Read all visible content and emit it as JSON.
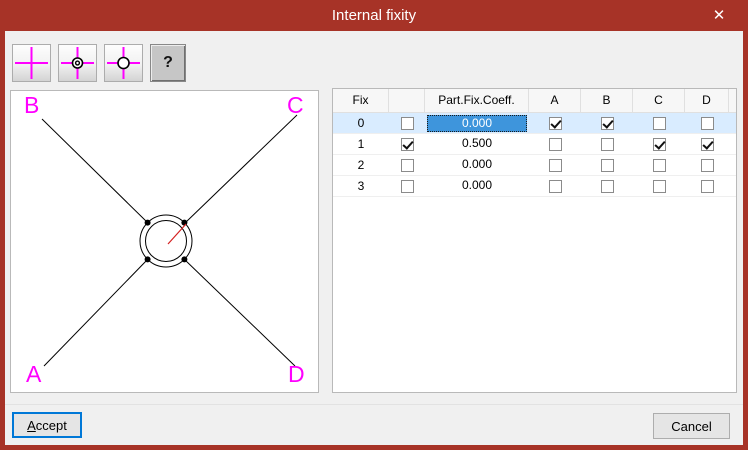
{
  "window": {
    "title": "Internal fixity",
    "close_icon": "✕"
  },
  "toolbar": {
    "buttons": [
      {
        "name": "fixity-rigid",
        "icon": "crosshair-icon"
      },
      {
        "name": "fixity-hinge-target",
        "icon": "crosshair-target-icon"
      },
      {
        "name": "fixity-hinge-circle",
        "icon": "crosshair-circle-icon"
      },
      {
        "name": "help",
        "label": "?"
      }
    ]
  },
  "diagram": {
    "labels": [
      "B",
      "C",
      "A",
      "D"
    ],
    "label_color": "#FF00FF",
    "line_color": "#000000",
    "pointer_color": "#D42020"
  },
  "table": {
    "headers": [
      "Fix",
      "",
      "Part.Fix.Coeff.",
      "A",
      "B",
      "C",
      "D"
    ],
    "rows": [
      {
        "fix": "0",
        "active": false,
        "coeff": "0.000",
        "marks": [
          true,
          true,
          false,
          false
        ],
        "selected": true,
        "highlighted": true
      },
      {
        "fix": "1",
        "active": true,
        "coeff": "0.500",
        "marks": [
          false,
          false,
          true,
          true
        ],
        "selected": false,
        "highlighted": false
      },
      {
        "fix": "2",
        "active": false,
        "coeff": "0.000",
        "marks": [
          false,
          false,
          false,
          false
        ],
        "selected": false,
        "highlighted": false
      },
      {
        "fix": "3",
        "active": false,
        "coeff": "0.000",
        "marks": [
          false,
          false,
          false,
          false
        ],
        "selected": false,
        "highlighted": false
      }
    ]
  },
  "footer": {
    "accept_label": "Accept",
    "cancel_label": "Cancel"
  },
  "colors": {
    "titlebar": "#A73327",
    "client_bg": "#F0F0F0",
    "selection_cell": "#3E95DC",
    "row_highlight": "#D9ECFF",
    "accent_magenta": "#FF00FF",
    "accept_border": "#0078D7"
  }
}
